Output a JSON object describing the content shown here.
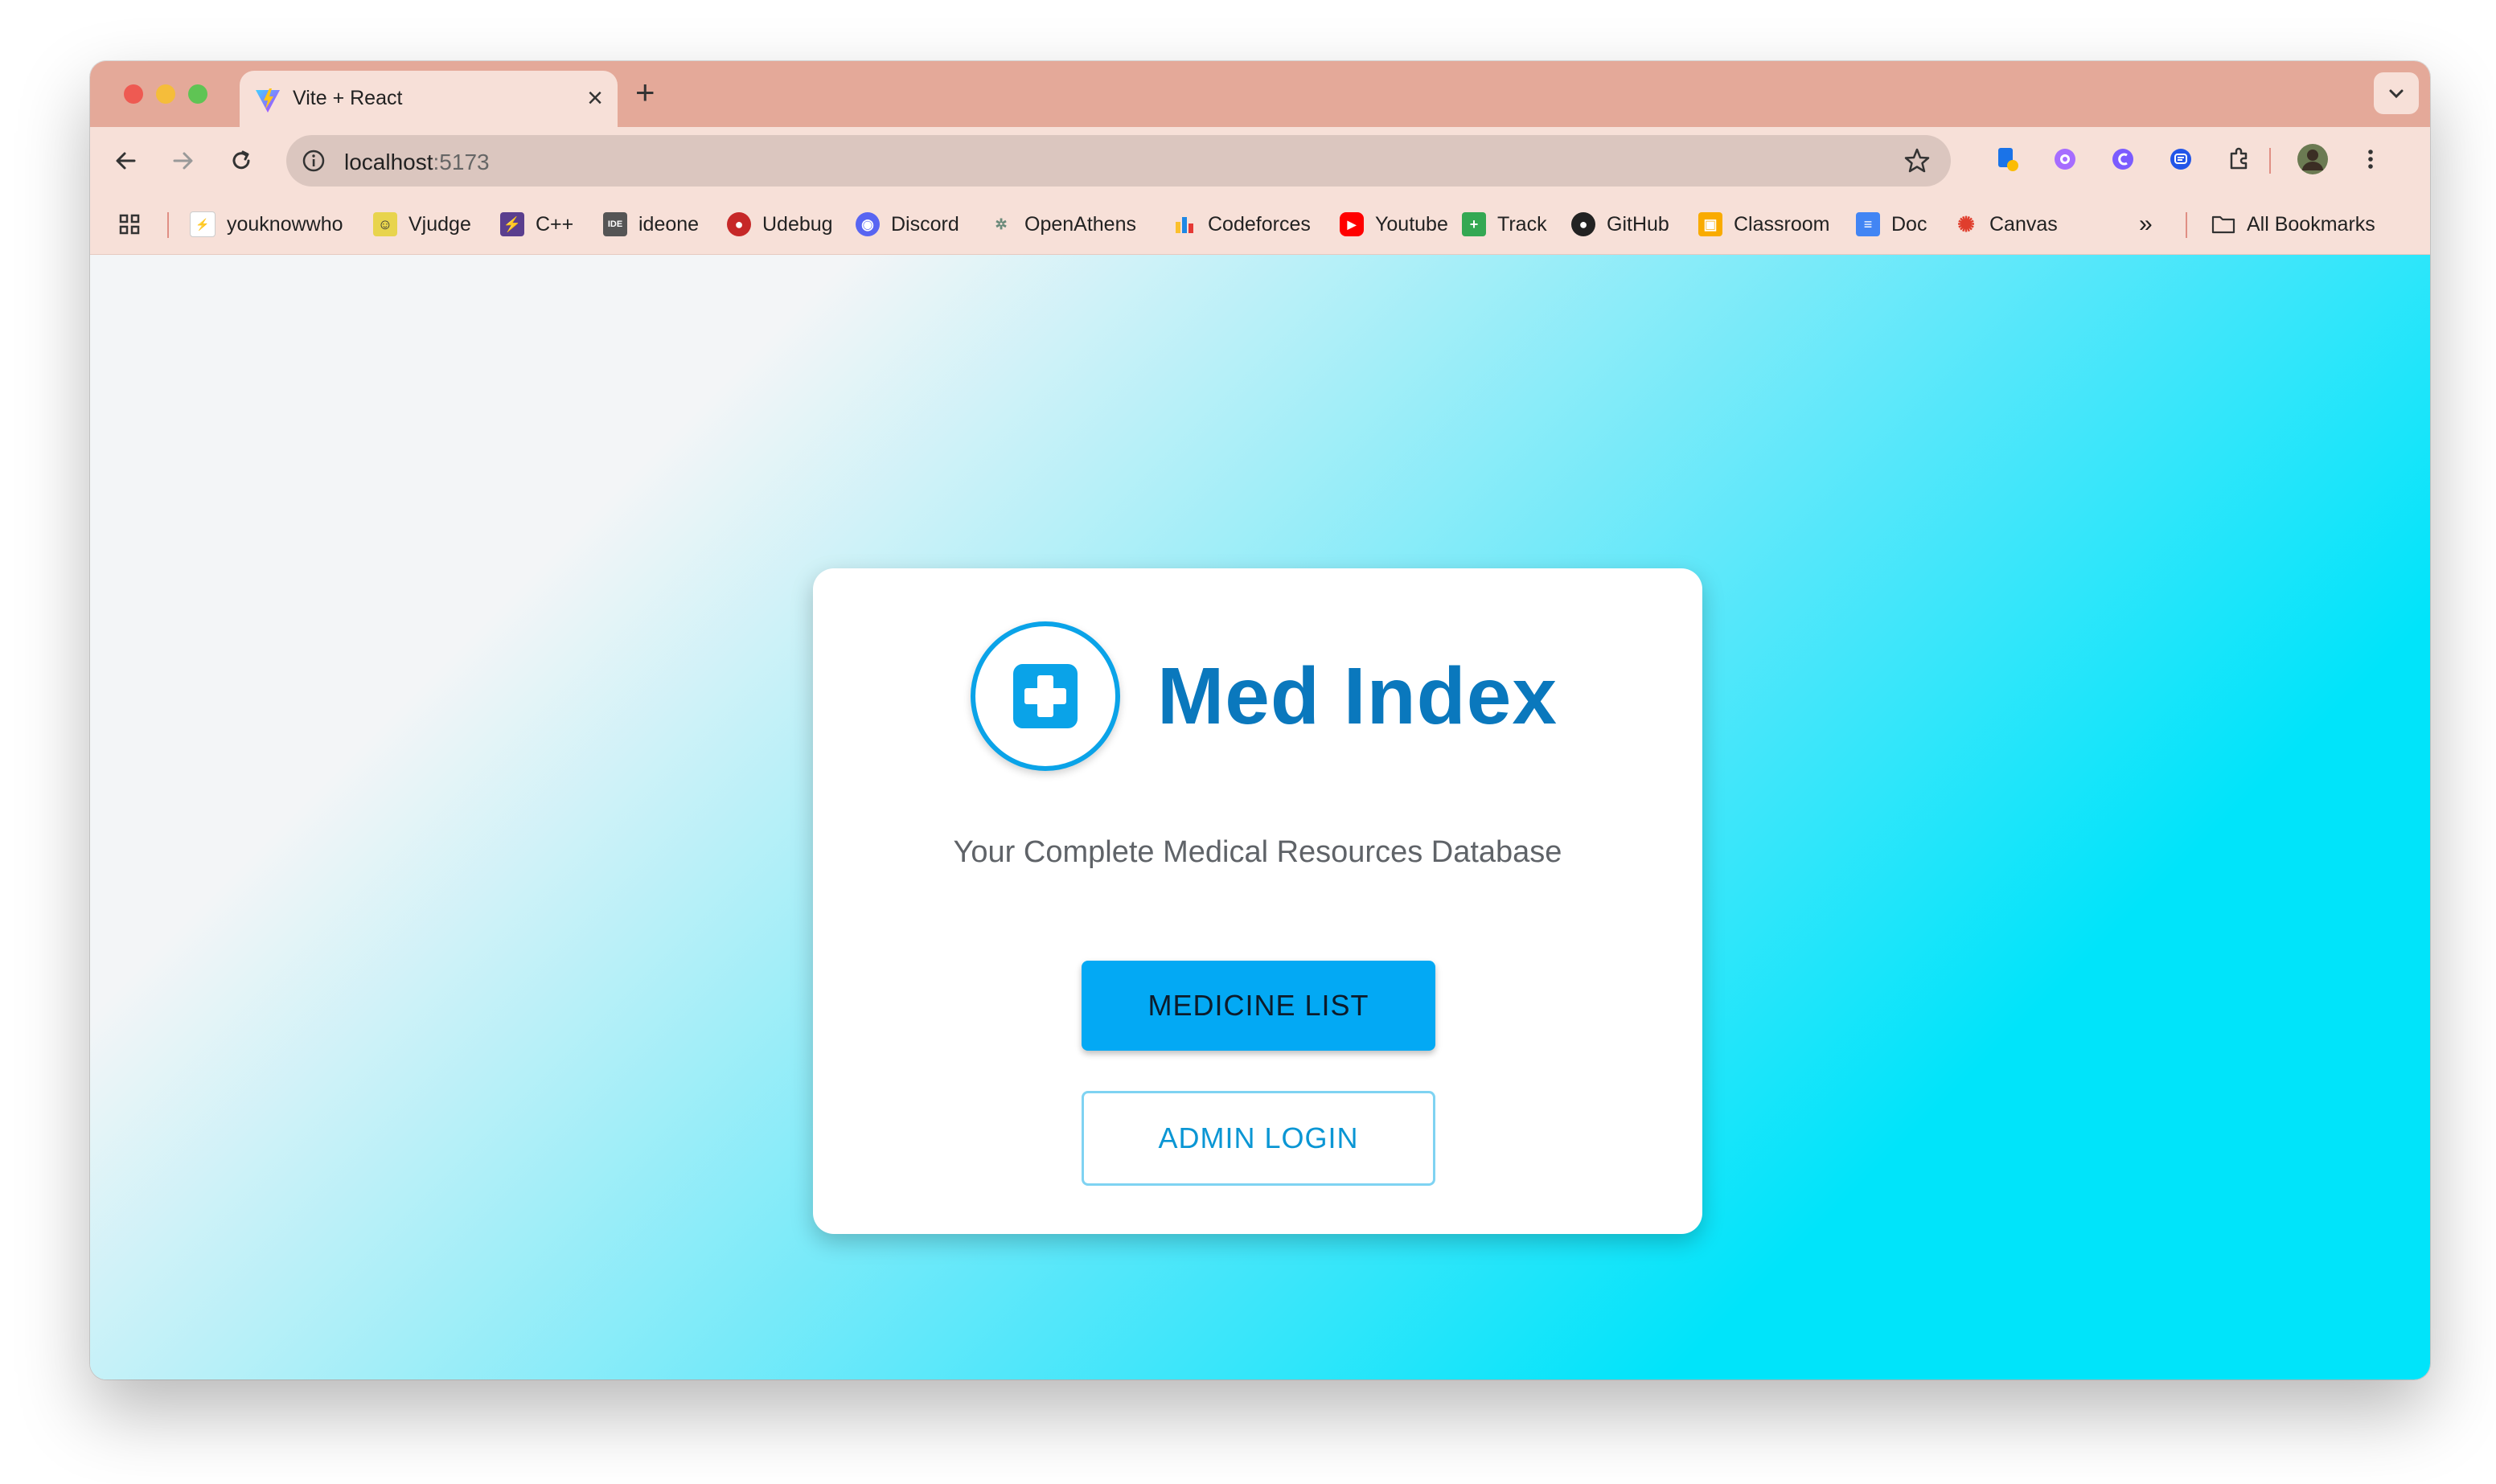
{
  "browser": {
    "tab_title": "Vite + React",
    "url_host": "localhost",
    "url_port": ":5173",
    "bookmarks": [
      {
        "label": "youknowwho",
        "icon": "youknowwho-icon"
      },
      {
        "label": "Vjudge",
        "icon": "vjudge-icon"
      },
      {
        "label": "C++",
        "icon": "cpp-icon"
      },
      {
        "label": "ideone",
        "icon": "ideone-icon"
      },
      {
        "label": "Udebug",
        "icon": "udebug-icon"
      },
      {
        "label": "Discord",
        "icon": "discord-icon"
      },
      {
        "label": "OpenAthens",
        "icon": "openathens-icon"
      },
      {
        "label": "Codeforces",
        "icon": "codeforces-icon"
      },
      {
        "label": "Youtube",
        "icon": "youtube-icon"
      },
      {
        "label": "Track",
        "icon": "track-icon"
      },
      {
        "label": "GitHub",
        "icon": "github-icon"
      },
      {
        "label": "Classroom",
        "icon": "classroom-icon"
      },
      {
        "label": "Doc",
        "icon": "doc-icon"
      },
      {
        "label": "Canvas",
        "icon": "canvas-icon"
      }
    ],
    "overflow_label": "»",
    "all_bookmarks_label": "All Bookmarks"
  },
  "app": {
    "title": "Med Index",
    "subtitle": "Your Complete Medical Resources Database",
    "primary_button": "MEDICINE LIST",
    "secondary_button": "ADMIN LOGIN"
  },
  "colors": {
    "brand_blue": "#0a78bd",
    "button_blue": "#03a9f4",
    "gradient_end": "#00e4fa"
  }
}
